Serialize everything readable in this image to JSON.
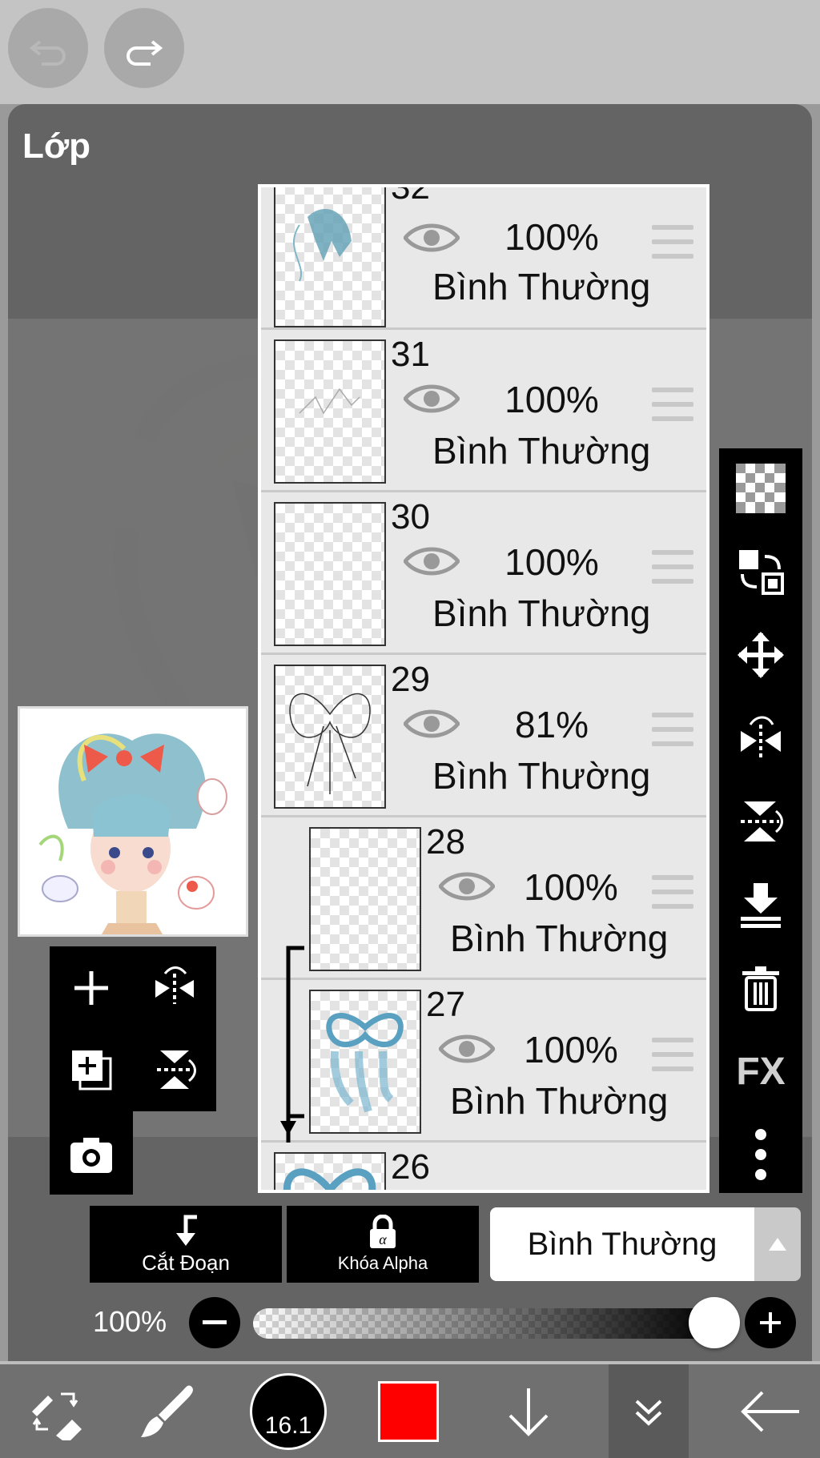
{
  "panel": {
    "title": "Lớp"
  },
  "layers": [
    {
      "number": "32",
      "opacity": "100%",
      "mode": "Bình Thường"
    },
    {
      "number": "31",
      "opacity": "100%",
      "mode": "Bình Thường"
    },
    {
      "number": "30",
      "opacity": "100%",
      "mode": "Bình Thường"
    },
    {
      "number": "29",
      "opacity": "81%",
      "mode": "Bình Thường"
    },
    {
      "number": "28",
      "opacity": "100%",
      "mode": "Bình Thường",
      "clipped": true
    },
    {
      "number": "27",
      "opacity": "100%",
      "mode": "Bình Thường",
      "clipped": true
    },
    {
      "number": "26"
    }
  ],
  "right_toolbar": {
    "fx_label": "FX"
  },
  "bottom": {
    "clip_label": "Cắt Đoạn",
    "alpha_lock_label": "Khóa Alpha",
    "blend_mode": "Bình Thường",
    "opacity_label": "100%",
    "opacity_value": 1.0
  },
  "nav": {
    "brush_size": "16.1",
    "color": "#ff0000"
  },
  "colors": {
    "panel_bg": "#606060",
    "accent_red": "#ff0000"
  }
}
